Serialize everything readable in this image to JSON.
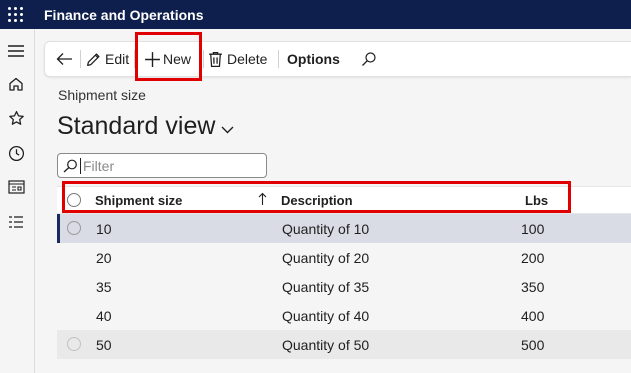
{
  "app": {
    "title": "Finance and Operations"
  },
  "toolbar": {
    "edit_label": "Edit",
    "new_label": "New",
    "delete_label": "Delete",
    "options_label": "Options"
  },
  "page": {
    "label": "Shipment size",
    "view_title": "Standard view"
  },
  "filter": {
    "placeholder": "Filter",
    "value": ""
  },
  "grid": {
    "columns": [
      "Shipment size",
      "Description",
      "Lbs"
    ],
    "sort": {
      "column": "Shipment size",
      "direction": "ascending"
    },
    "rows": [
      {
        "size": "10",
        "description": "Quantity of 10",
        "lbs": "100"
      },
      {
        "size": "20",
        "description": "Quantity of 20",
        "lbs": "200"
      },
      {
        "size": "35",
        "description": "Quantity of 35",
        "lbs": "350"
      },
      {
        "size": "40",
        "description": "Quantity of 40",
        "lbs": "400"
      },
      {
        "size": "50",
        "description": "Quantity of 50",
        "lbs": "500"
      }
    ],
    "selected_row": 0
  },
  "icons": {
    "waffle": "app-launcher-icon",
    "back": "back-arrow-icon",
    "edit": "pencil-icon",
    "new": "plus-icon",
    "delete": "trash-icon",
    "search": "search-icon",
    "nav": [
      "hamburger-icon",
      "home-icon",
      "star-icon",
      "clock-icon",
      "workspace-icon",
      "list-icon"
    ]
  },
  "colors": {
    "topbar": "#0e1f4d",
    "highlight": "#e00000",
    "selected_row": "#d9dce5",
    "selected_marker": "#1b2a5e"
  }
}
